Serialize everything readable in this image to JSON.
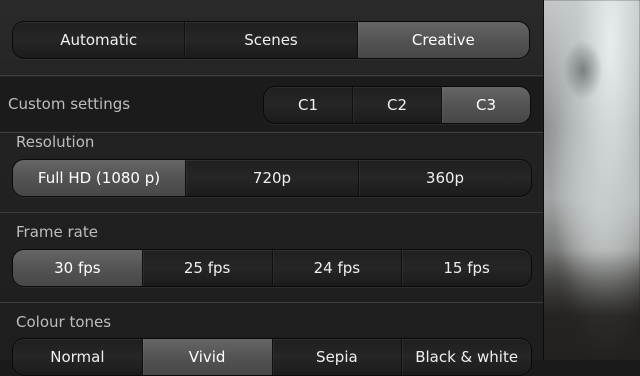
{
  "mode": {
    "options": [
      "Automatic",
      "Scenes",
      "Creative"
    ],
    "selected": 2
  },
  "custom_settings": {
    "label": "Custom settings",
    "options": [
      "C1",
      "C2",
      "C3"
    ],
    "selected": 2
  },
  "resolution": {
    "label": "Resolution",
    "options": [
      "Full HD (1080 p)",
      "720p",
      "360p"
    ],
    "selected": 0
  },
  "frame_rate": {
    "label": "Frame rate",
    "options": [
      "30 fps",
      "25 fps",
      "24 fps",
      "15 fps"
    ],
    "selected": 0
  },
  "colour_tones": {
    "label": "Colour tones",
    "options": [
      "Normal",
      "Vivid",
      "Sepia",
      "Black & white"
    ],
    "selected": 1
  },
  "colors": {
    "selected_segment": "#5a5a5a",
    "panel_background": "#222222",
    "label_text": "#bdbdbd"
  }
}
